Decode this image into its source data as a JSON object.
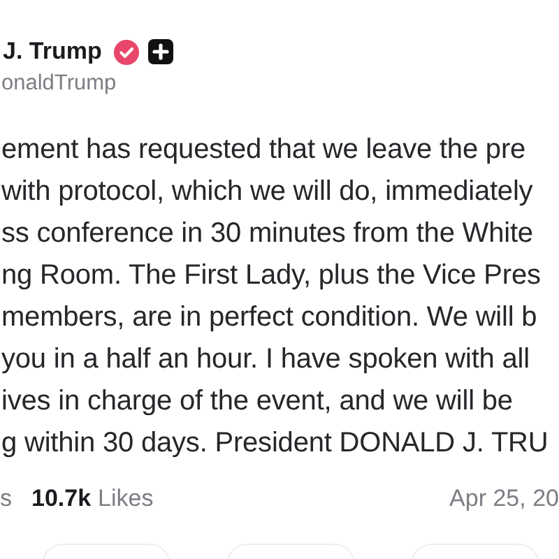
{
  "author": {
    "name": "J. Trump",
    "handle": "onaldTrump",
    "verified": true
  },
  "post": {
    "lines": [
      "ement has requested that we leave the pre",
      "with protocol, which we will do, immediately",
      "ss conference in 30 minutes from the White",
      "ng Room. The First Lady, plus the Vice Pres",
      "members, are in perfect condition. We will b",
      "you in a half an hour. I have spoken with all",
      "ives in charge of the event, and we will be",
      "g within 30 days. President DONALD J. TRU"
    ]
  },
  "stats": {
    "prev_label": "s",
    "likes_count": "10.7k",
    "likes_label": "Likes",
    "date": "Apr 25, 20"
  }
}
